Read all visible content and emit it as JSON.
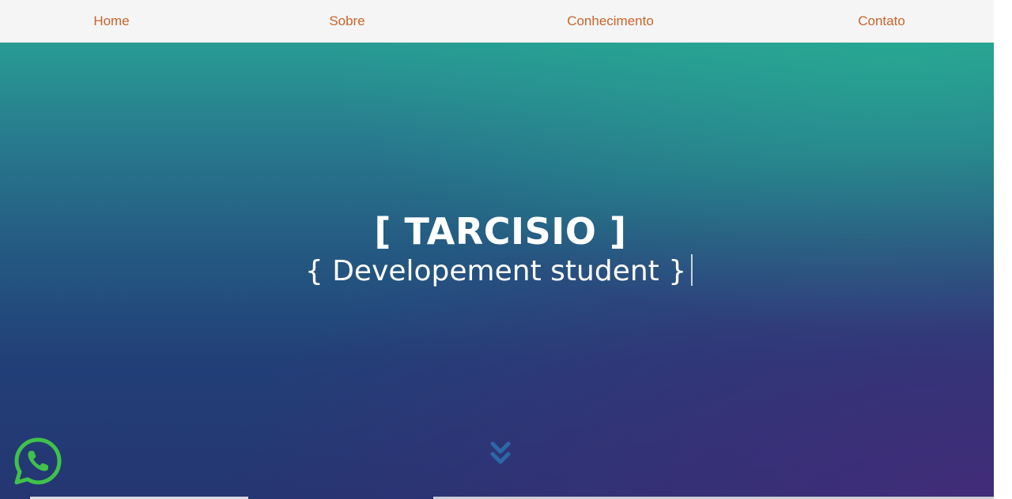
{
  "nav": {
    "items": [
      {
        "label": "Home"
      },
      {
        "label": "Sobre"
      },
      {
        "label": "Conhecimento"
      },
      {
        "label": "Contato"
      }
    ]
  },
  "hero": {
    "title": "[ TARCISIO ]",
    "subtitle": "{ Developement student }"
  },
  "icons": {
    "scroll": "chevron-double-down-icon",
    "whatsapp": "whatsapp-icon"
  },
  "colors": {
    "nav_link": "#c8642a",
    "nav_bg": "#f5f5f5",
    "hero_top": "#289c94",
    "hero_bottom": "#253672",
    "whatsapp_green": "#3fc24a"
  }
}
